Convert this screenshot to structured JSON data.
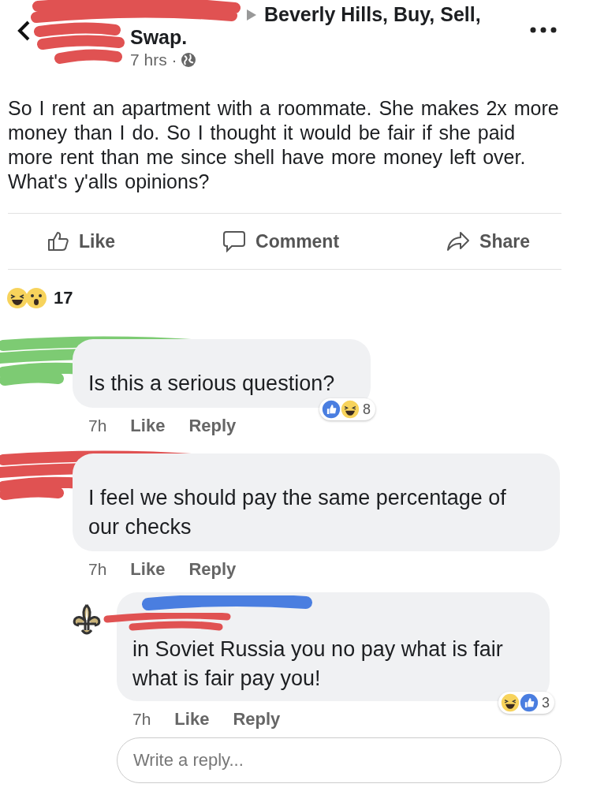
{
  "header": {
    "group": "Beverly Hills, Buy, Sell,",
    "group_cont": "Swap.",
    "time": "7 hrs ·"
  },
  "post": {
    "text": "So I rent an apartment with a roommate. She makes 2x more money than I do. So I thought it would be fair if she paid more rent than me since shell have more money left over. What's y'alls opinions?"
  },
  "actions": [
    {
      "kind": "like",
      "label": "Like"
    },
    {
      "kind": "comment",
      "label": "Comment"
    },
    {
      "kind": "share",
      "label": "Share"
    }
  ],
  "reactions": {
    "icons": [
      {
        "kind": "haha"
      },
      {
        "kind": "wow"
      }
    ],
    "count": "17"
  },
  "comments": [
    {
      "text": "Is this a serious question?",
      "time": "7h",
      "like": "Like",
      "reply": "Reply",
      "reactions": {
        "icons": [
          {
            "kind": "like"
          },
          {
            "kind": "haha"
          }
        ],
        "count": "8"
      }
    },
    {
      "text": "I feel we should pay the same percentage of our checks",
      "time": "7h",
      "like": "Like",
      "reply": "Reply",
      "children": [
        {
          "text": "in Soviet Russia you no pay what is fair what is fair pay you!",
          "time": "7h",
          "like": "Like",
          "reply": "Reply",
          "reactions": {
            "icons": [
              {
                "kind": "haha"
              },
              {
                "kind": "like"
              }
            ],
            "count": "3"
          }
        }
      ]
    }
  ],
  "reply_box": {
    "placeholder": "Write a reply..."
  }
}
